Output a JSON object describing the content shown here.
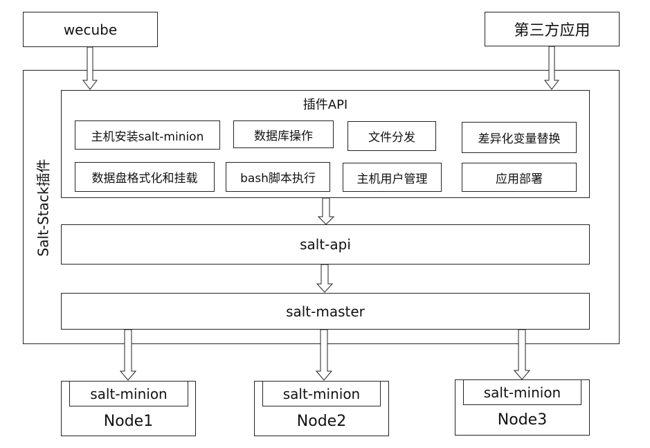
{
  "top": {
    "wecube": "wecube",
    "third_party": "第三方应用"
  },
  "container": {
    "label": "Salt-Stack插件"
  },
  "plugin_api": {
    "title": "插件API",
    "items": [
      "主机安装salt-minion",
      "数据库操作",
      "文件分发",
      "差异化变量替换",
      "数据盘格式化和挂载",
      "bash脚本执行",
      "主机用户管理",
      "应用部署"
    ]
  },
  "salt_api": "salt-api",
  "salt_master": "salt-master",
  "nodes": [
    {
      "minion": "salt-minion",
      "name": "Node1"
    },
    {
      "minion": "salt-minion",
      "name": "Node2"
    },
    {
      "minion": "salt-minion",
      "name": "Node3"
    }
  ]
}
